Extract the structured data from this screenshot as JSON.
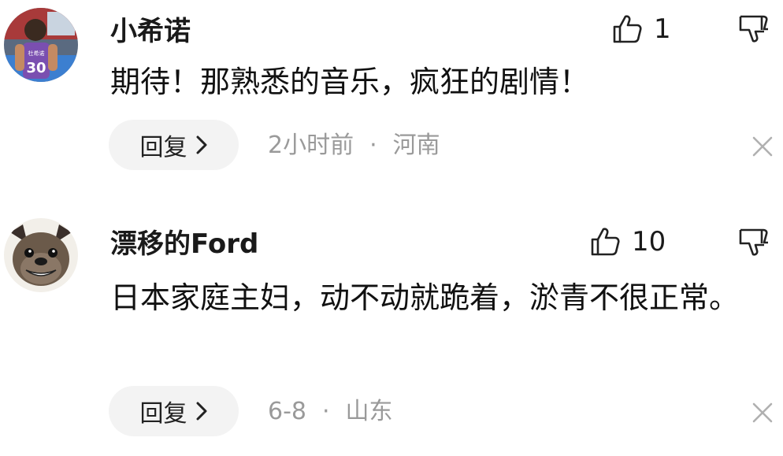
{
  "comments": [
    {
      "username": "小希诺",
      "text": "期待！那熟悉的音乐，疯狂的剧情！",
      "likes": "1",
      "reply_label": "回复",
      "time": "2小时前",
      "separator": "·",
      "location": "河南",
      "avatar": {
        "jersey_number": "30",
        "jersey_text": "杜希诺"
      }
    },
    {
      "username": "漂移的Ford",
      "text": "日本家庭主妇，动不动就跪着，淤青不很正常。",
      "likes": "10",
      "reply_label": "回复",
      "time": "6-8",
      "separator": "·",
      "location": "山东"
    }
  ],
  "colors": {
    "meta_text": "#9a9a9a",
    "reply_bg": "#f3f3f3",
    "icon_stroke": "#222222"
  },
  "icons": [
    "thumbs-up-icon",
    "thumbs-down-icon",
    "chevron-right-icon",
    "close-icon"
  ]
}
